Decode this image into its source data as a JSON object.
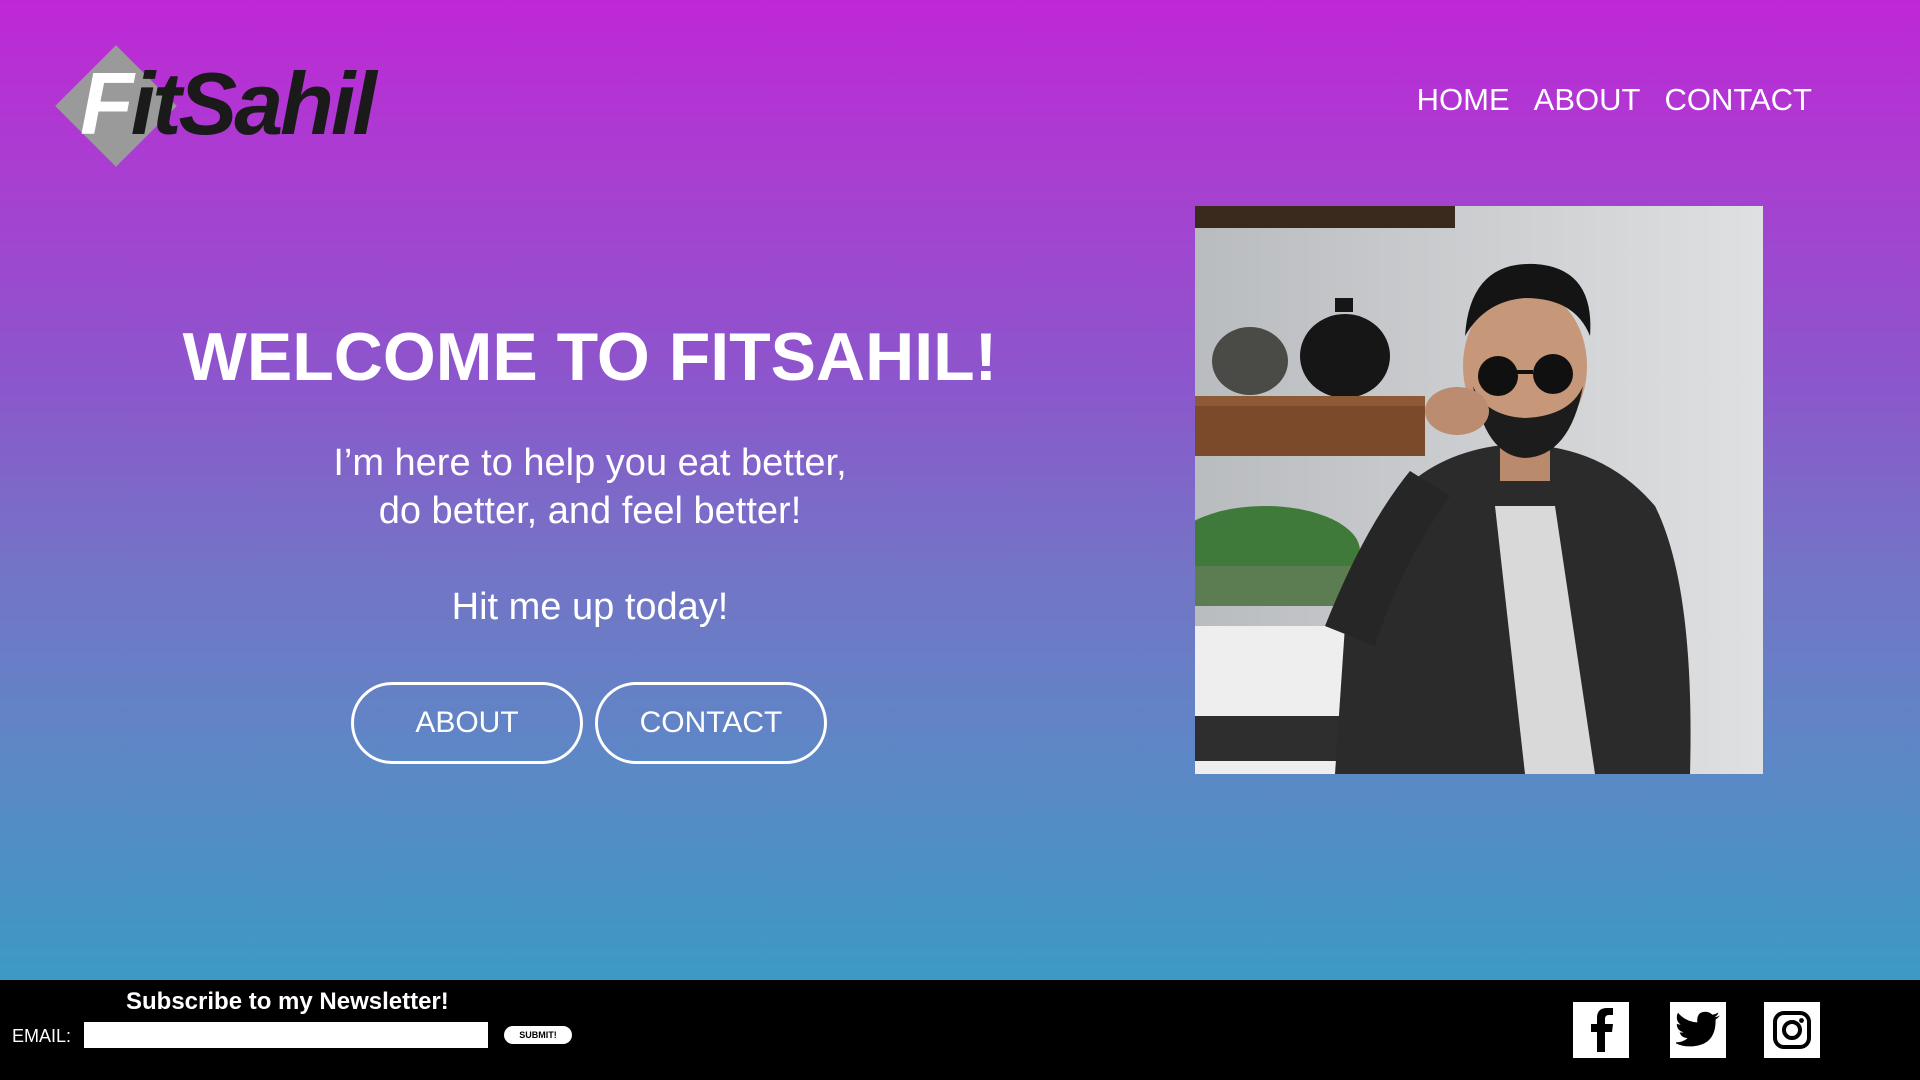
{
  "brand": {
    "logo_text": "FitSahil",
    "logo_first": "F",
    "logo_rest": "itSahil"
  },
  "nav": {
    "items": [
      "HOME",
      "ABOUT",
      "CONTACT"
    ]
  },
  "hero": {
    "title": "WELCOME TO FITSAHIL!",
    "line1": "I’m here to help you eat better,",
    "line2": "do better, and feel better!",
    "line3": "Hit me up today!",
    "buttons": [
      "ABOUT",
      "CONTACT"
    ]
  },
  "newsletter": {
    "title": "Subscribe to my Newsletter!",
    "email_label": "EMAIL:",
    "email_value": "",
    "submit_label": "SUBMIT!"
  },
  "social": {
    "icons": [
      "facebook-icon",
      "twitter-icon",
      "instagram-icon"
    ]
  },
  "colors": {
    "gradient_top": "#bf27d6",
    "gradient_bottom": "#3c9ac4",
    "footer": "#000000",
    "text": "#ffffff"
  }
}
